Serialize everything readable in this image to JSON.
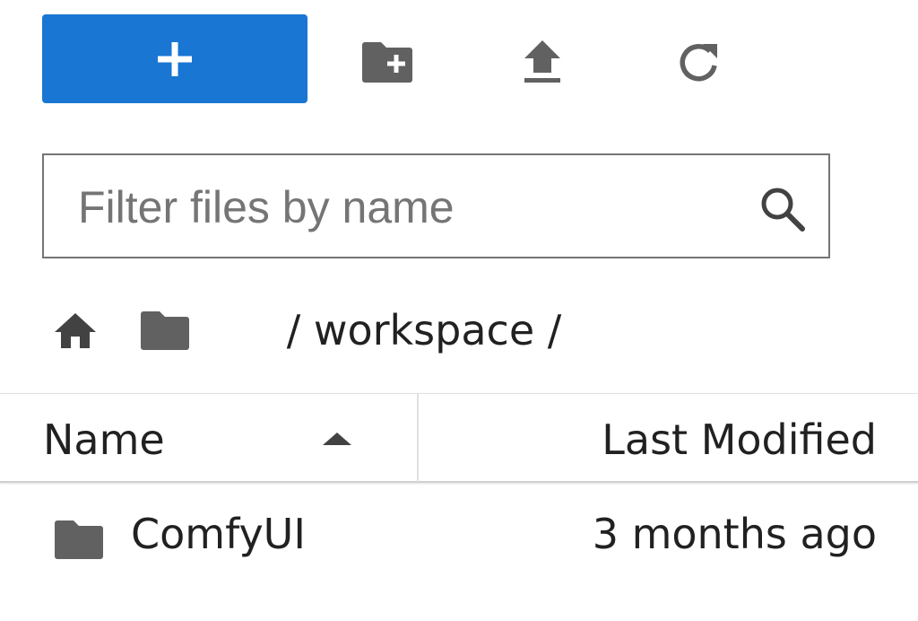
{
  "toolbar": {
    "new_label": "+",
    "new_folder_icon": "new-folder-icon",
    "upload_icon": "upload-icon",
    "refresh_icon": "refresh-icon",
    "accent_color": "#1976d2"
  },
  "filter": {
    "placeholder": "Filter files by name",
    "value": "",
    "icon": "search-icon"
  },
  "breadcrumb": {
    "home_icon": "home-icon",
    "folder_icon": "folder-icon",
    "separator_leading": "/ ",
    "current": "workspace",
    "separator_trailing": " /"
  },
  "columns": {
    "name": "Name",
    "name_sort": "ascending",
    "last_modified": "Last Modified"
  },
  "files": [
    {
      "type": "folder",
      "name": "ComfyUI",
      "modified": "3 months ago"
    }
  ]
}
